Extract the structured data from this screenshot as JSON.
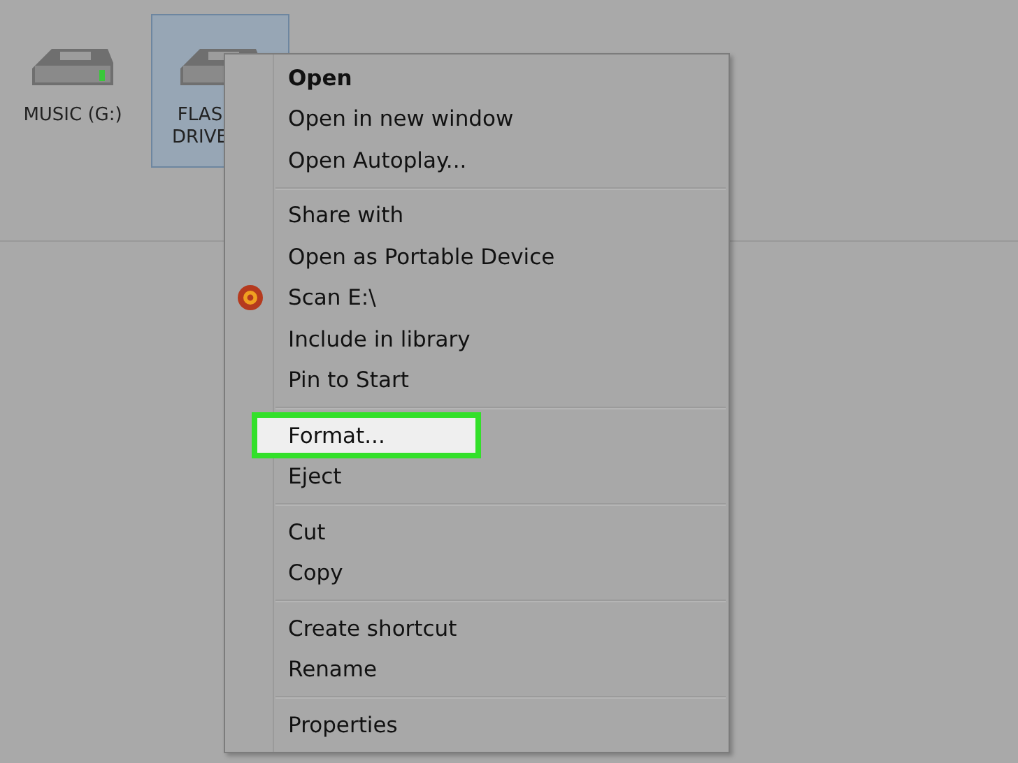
{
  "drives": [
    {
      "label": "MUSIC (G:)",
      "selected": false
    },
    {
      "label": "FLAS DRIVE",
      "selected": true
    }
  ],
  "context_menu": {
    "groups": [
      [
        {
          "label": "Open",
          "kind": "default",
          "selected": false
        },
        {
          "label": "Open in new window",
          "kind": "plain",
          "selected": false
        },
        {
          "label": "Open Autoplay...",
          "kind": "plain",
          "selected": false
        }
      ],
      [
        {
          "label": "Share with",
          "kind": "plain",
          "selected": false
        },
        {
          "label": "Open as Portable Device",
          "kind": "plain",
          "selected": false
        },
        {
          "label": "Scan E:\\",
          "kind": "icon",
          "selected": false
        },
        {
          "label": "Include in library",
          "kind": "plain",
          "selected": false
        },
        {
          "label": "Pin to Start",
          "kind": "plain",
          "selected": false
        }
      ],
      [
        {
          "label": "Format...",
          "kind": "plain",
          "selected": true
        },
        {
          "label": "Eject",
          "kind": "plain",
          "selected": false
        }
      ],
      [
        {
          "label": "Cut",
          "kind": "plain",
          "selected": false
        },
        {
          "label": "Copy",
          "kind": "plain",
          "selected": false
        }
      ],
      [
        {
          "label": "Create shortcut",
          "kind": "plain",
          "selected": false
        },
        {
          "label": "Rename",
          "kind": "plain",
          "selected": false
        }
      ],
      [
        {
          "label": "Properties",
          "kind": "plain",
          "selected": false
        }
      ]
    ]
  }
}
